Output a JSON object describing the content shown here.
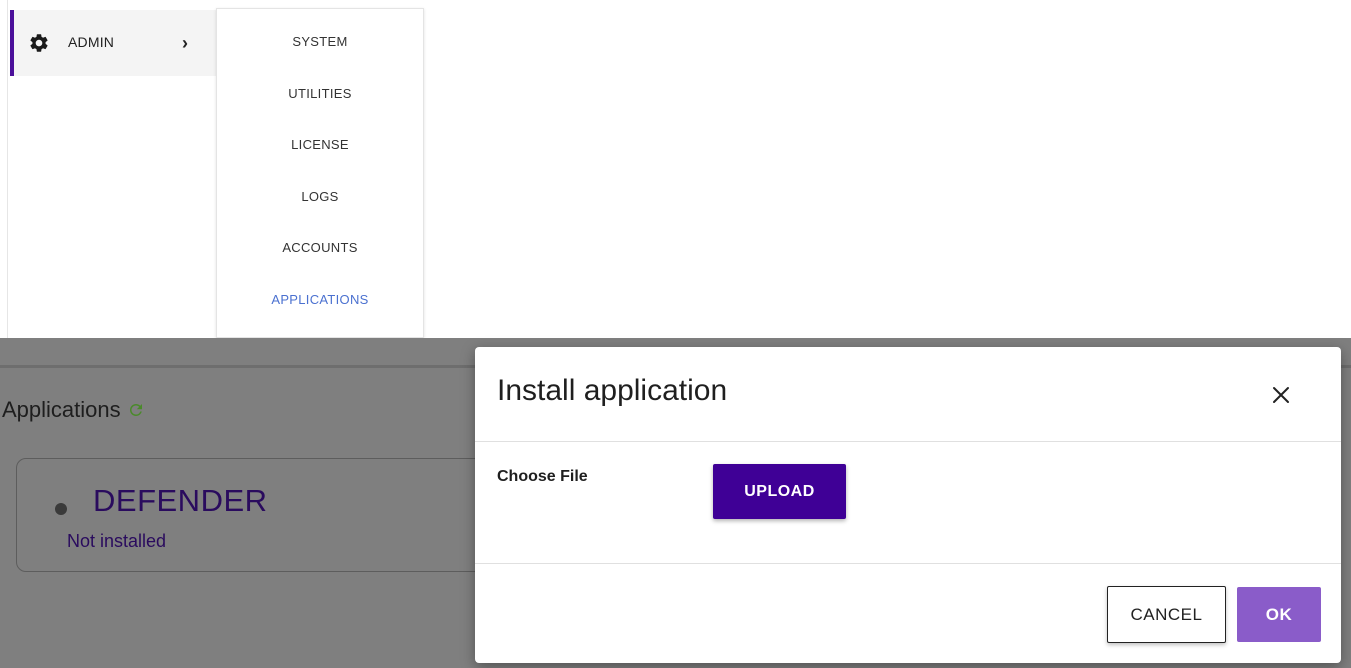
{
  "sidebar": {
    "admin": {
      "label": "ADMIN",
      "icon": "gear-icon",
      "accent_color": "#4b0f9a"
    }
  },
  "submenu": {
    "items": [
      {
        "label": "SYSTEM"
      },
      {
        "label": "UTILITIES"
      },
      {
        "label": "LICENSE"
      },
      {
        "label": "LOGS"
      },
      {
        "label": "ACCOUNTS"
      },
      {
        "label": "APPLICATIONS",
        "active": true
      }
    ],
    "active_color": "#4b71d0"
  },
  "page": {
    "title": "Applications",
    "refresh_icon": "refresh-icon",
    "apps": [
      {
        "name": "DEFENDER",
        "status": "Not installed"
      }
    ]
  },
  "modal": {
    "title": "Install application",
    "choose_label": "Choose File",
    "upload_label": "UPLOAD",
    "cancel_label": "CANCEL",
    "ok_label": "OK",
    "primary_color": "#3f0096",
    "ok_color": "#8a5cc9"
  }
}
